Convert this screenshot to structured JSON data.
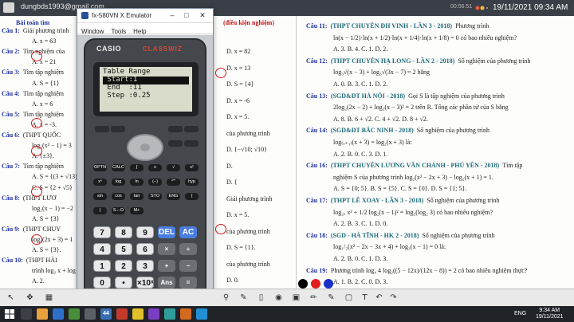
{
  "top": {
    "email": "dungbds1993@gmail.com",
    "clock": "19/11/2021 09:34 AM",
    "rec": "00:56:51"
  },
  "doc_left": {
    "title_a": "Bài toán tìm",
    "title_b": "(điều kiện nghiệm)",
    "rows": [
      {
        "label": "Câu 1:",
        "text": "Giải phương trình"
      },
      {
        "label": "",
        "text": "A. x = 63"
      },
      {
        "label": "Câu 2:",
        "text": "Tìm nghiệm của"
      },
      {
        "label": "",
        "text": "A. x = 21"
      },
      {
        "label": "Câu 3:",
        "text": "Tìm tập nghiệm"
      },
      {
        "label": "",
        "text": "A. S = {1}"
      },
      {
        "label": "Câu 4:",
        "text": "Tìm tập nghiệm"
      },
      {
        "label": "",
        "text": "A. x = 6"
      },
      {
        "label": "Câu 5:",
        "text": "Tìm tập nghiệm"
      },
      {
        "label": "",
        "text": "A. x = -3."
      },
      {
        "label": "Câu 6:",
        "text": "(THPT QUỐC"
      },
      {
        "label": "",
        "text": "log₂(x² − 1) = 3"
      },
      {
        "label": "",
        "text": "A. {±3}."
      },
      {
        "label": "Câu 7:",
        "text": "Tìm tập nghiệm"
      },
      {
        "label": "",
        "text": "A. S = {(3 + √13)/2}"
      },
      {
        "label": "",
        "text": "C. S = {2 + √5}"
      },
      {
        "label": "Câu 8:",
        "text": "(THPT LƯƠ"
      },
      {
        "label": "",
        "text": "log₂(x − 1) = −2"
      },
      {
        "label": "",
        "text": "A. S = {3}"
      },
      {
        "label": "Câu 9:",
        "text": "(THPT CHUY"
      },
      {
        "label": "",
        "text": "log₃(2x + 3) = 1"
      },
      {
        "label": "",
        "text": "A. S = {3}."
      },
      {
        "label": "Câu 10:",
        "text": "(THPT HẢI"
      },
      {
        "label": "",
        "text": "trình log₂ x + log"
      },
      {
        "label": "",
        "text": "A. 2."
      }
    ],
    "right_col": [
      "D. x = 82",
      "D. x = 13",
      "D. S = {4}",
      "D. x = -6",
      "D. x = 5.",
      "của phương trình",
      "D. {−√10; √10}",
      "D.",
      "D. {",
      "Giải phương trình",
      "D. x = 5.",
      "của phương trình",
      "D. S = {1}.",
      "của phương trình",
      "D. 0."
    ]
  },
  "doc_right": {
    "rows": [
      {
        "cau": "Câu 11:",
        "src": "(THPT CHUYÊN ĐH VINH - LẦN 3 - 2018)",
        "text": "Phương trình"
      },
      {
        "cau": "",
        "src": "",
        "text": "ln(x − 1/2)·ln(x + 1/2)·ln(x + 1/4)·ln(x + 1/8) = 0 có bao nhiêu nghiệm?"
      },
      {
        "cau": "",
        "src": "",
        "text": "A. 3.        B. 4.        C. 1.        D. 2."
      },
      {
        "cau": "Câu 12:",
        "src": "(THPT CHUYÊN HẠ LONG - LẦN 2 - 2018)",
        "text": "Số nghiệm của phương trình"
      },
      {
        "cau": "",
        "src": "",
        "text": "log₃√(x − 3) + log₃√(3x − 7) = 2 bằng"
      },
      {
        "cau": "",
        "src": "",
        "text": "A. 0.        B. 3.        C. 1.        D. 2."
      },
      {
        "cau": "Câu 13:",
        "src": "(SGD&ĐT HÀ NỘI - 2018)",
        "text": "Gọi S là tập nghiệm của phương trình"
      },
      {
        "cau": "",
        "src": "",
        "text": "2log₂(2x − 2) + log₂(x − 3)² = 2 trên R. Tổng các phần tử của S bằng"
      },
      {
        "cau": "",
        "src": "",
        "text": "A. 8.        B. 6 + √2.        C. 4 + √2.        D. 8 + √2."
      },
      {
        "cau": "Câu 14:",
        "src": "(SGD&ĐT BẮC NINH - 2018)",
        "text": "Số nghiệm của phương trình"
      },
      {
        "cau": "",
        "src": "",
        "text": "log₍ₓ₊₁₎(x + 3) = log₂(x + 3) là:"
      },
      {
        "cau": "",
        "src": "",
        "text": "A. 2.        B. 0.        C. 3.        D. 1."
      },
      {
        "cau": "Câu 16:",
        "src": "(THPT CHUYÊN LƯƠNG VĂN CHÁNH - PHÚ YÊN - 2018)",
        "text": "Tìm tập"
      },
      {
        "cau": "",
        "src": "",
        "text": "nghiệm S của phương trình log₂(x² − 2x + 3) − log₂(x + 1) = 1."
      },
      {
        "cau": "",
        "src": "",
        "text": "A. S = {0; 5}.        B. S = {5}.        C. S = {0}.        D. S = {1; 5}."
      },
      {
        "cau": "Câu 17:",
        "src": "(THPT LÊ XOAY - LẦN 3 - 2018)",
        "text": "Số nghiệm của phương trình"
      },
      {
        "cau": "",
        "src": "",
        "text": "log₂ₓ x² + 1/2 log₂(x − 1)² = log₂(log₂ 3) có bao nhiêu nghiệm?"
      },
      {
        "cau": "",
        "src": "",
        "text": "A. 2.        B. 3.        C. 1.        D. 0."
      },
      {
        "cau": "Câu 18:",
        "src": "(SGD - HÀ TĨNH - HK 2 - 2018)",
        "text": "Số nghiệm của phương trình"
      },
      {
        "cau": "",
        "src": "",
        "text": "log₁/₂(x² − 2x − 3x + 4) + log₂(x − 1) = 0 là:"
      },
      {
        "cau": "",
        "src": "",
        "text": "A. 2.        B. 0.        C. 1.        D. 3."
      },
      {
        "cau": "Câu 19:",
        "src": "",
        "text": "Phương trình log₄ 4 log₂((5 − 12x)/(12x − 8)) = 2 có bao nhiêu nghiệm thực?"
      },
      {
        "cau": "",
        "src": "",
        "text": "A. 1.        B. 2.        C. 0.        D. 3."
      }
    ]
  },
  "emulator": {
    "title": "fx-580VN X Emulator",
    "menu": [
      "Window",
      "Tools",
      "Help"
    ],
    "brand": "CASIO",
    "model": "CLASSWIZ",
    "screen_lines": [
      "Table Range",
      " Start:1",
      " End  :11",
      " Step :0.25"
    ],
    "highlight_index": 1,
    "soft_keys": [
      "OPTN",
      "CALC",
      "∫",
      "x",
      "√",
      "x²",
      "xⁿ",
      "log",
      "ln",
      "(−)",
      "°'\"",
      "hyp",
      "sin",
      "cos",
      "tan",
      "STO",
      "ENG",
      "(",
      ")",
      "S⇔D",
      "M+"
    ],
    "num_keys": [
      [
        "7",
        "8",
        "9",
        "DEL",
        "AC"
      ],
      [
        "4",
        "5",
        "6",
        "×",
        "÷"
      ],
      [
        "1",
        "2",
        "3",
        "+",
        "−"
      ],
      [
        "0",
        "•",
        "×10ˣ",
        "Ans",
        "="
      ]
    ]
  },
  "toolbar": {
    "icons": [
      "cursor-icon",
      "move-icon",
      "grid-icon",
      "magnify-icon",
      "pen-icon",
      "eraser-icon",
      "text-icon",
      "undo-icon",
      "redo-icon"
    ]
  },
  "colors": {
    "black": "#000000",
    "red": "#e21b1b",
    "blue": "#1830c8"
  },
  "taskbar": {
    "time": "9:34 AM",
    "date": "19/11/2021",
    "lang": "ENG",
    "badge": "44"
  }
}
